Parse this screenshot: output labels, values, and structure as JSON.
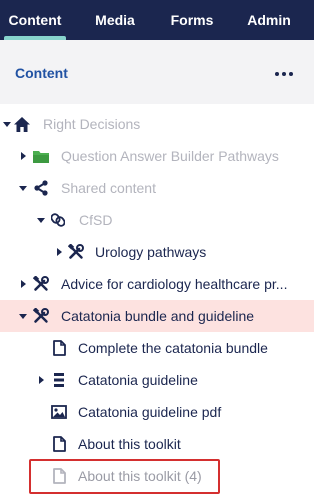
{
  "nav": {
    "tabs": [
      {
        "label": "Content",
        "active": true
      },
      {
        "label": "Media",
        "active": false
      },
      {
        "label": "Forms",
        "active": false
      },
      {
        "label": "Admin",
        "active": false
      }
    ]
  },
  "panel": {
    "title": "Content",
    "more_icon": "ellipsis-icon"
  },
  "tree": {
    "items": [
      {
        "label": "Right Decisions",
        "icon": "home-icon",
        "caret": "expanded",
        "style": "muted"
      },
      {
        "label": "Question Answer Builder Pathways",
        "icon": "folder-icon",
        "caret": "collapsed",
        "style": "muted"
      },
      {
        "label": "Shared content",
        "icon": "share-icon",
        "caret": "expanded",
        "style": "muted"
      },
      {
        "label": "CfSD",
        "icon": "chain-link-icon",
        "caret": "expanded",
        "style": "muted"
      },
      {
        "label": "Urology pathways",
        "icon": "tools-icon",
        "caret": "collapsed",
        "style": "dark"
      },
      {
        "label": "Advice for cardiology healthcare pr...",
        "icon": "tools-icon",
        "caret": "collapsed",
        "style": "dark"
      },
      {
        "label": "Catatonia bundle and guideline",
        "icon": "tools-icon",
        "caret": "expanded",
        "style": "dark",
        "selected": true
      },
      {
        "label": "Complete the catatonia bundle",
        "icon": "document-icon",
        "caret": "none",
        "style": "dark"
      },
      {
        "label": "Catatonia guideline",
        "icon": "list-icon",
        "caret": "collapsed",
        "style": "dark"
      },
      {
        "label": "Catatonia guideline pdf",
        "icon": "image-icon",
        "caret": "none",
        "style": "dark"
      },
      {
        "label": "About this toolkit",
        "icon": "document-icon",
        "caret": "none",
        "style": "dark"
      },
      {
        "label": "About this toolkit (4)",
        "icon": "document-icon",
        "caret": "none",
        "style": "muted",
        "highlighted": true
      }
    ]
  },
  "colors": {
    "nav_background": "#1b264f",
    "active_tab_indicator": "#87d3cd",
    "selected_row": "#fde2e0",
    "highlight_border": "#d42f2f",
    "folder_green": "#4caf50"
  }
}
